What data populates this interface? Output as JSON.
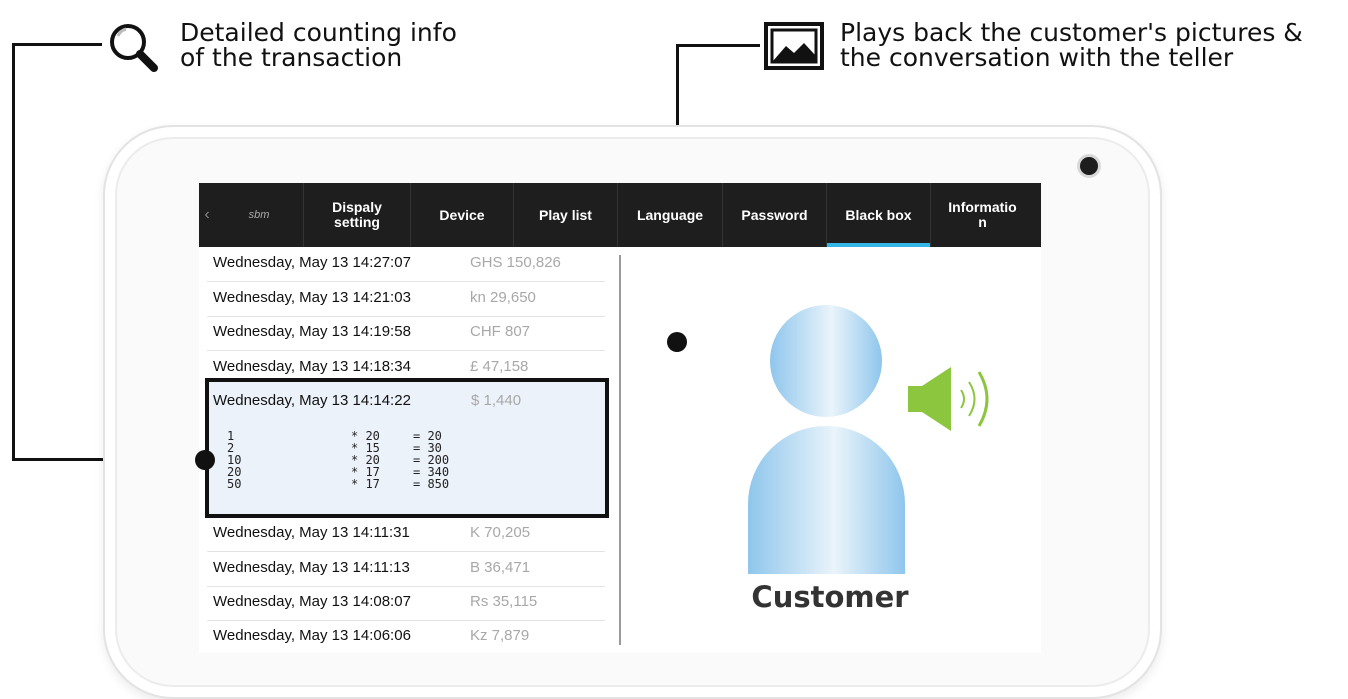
{
  "callouts": {
    "left": "Detailed counting info\nof the transaction",
    "right": "Plays back the customer's pictures &\nthe conversation with the teller"
  },
  "nav": {
    "back": "‹",
    "logo": "sbm",
    "tabs": [
      "Dispaly\nsetting",
      "Device",
      "Play list",
      "Language",
      "Password",
      "Black box",
      "Informatio\nn"
    ],
    "active_tab": "Black box",
    "accent_color": "#33b5e5"
  },
  "transactions": [
    {
      "datetime": "Wednesday, May 13  14:27:07",
      "amount": "GHS 150,826"
    },
    {
      "datetime": "Wednesday, May 13  14:21:03",
      "amount": "kn 29,650"
    },
    {
      "datetime": "Wednesday, May 13  14:19:58",
      "amount": "CHF 807"
    },
    {
      "datetime": "Wednesday, May 13  14:18:34",
      "amount": "£ 47,158"
    },
    {
      "datetime": "Wednesday, May 13  14:14:22",
      "amount": "$ 1,440"
    },
    {
      "datetime": "Wednesday, May 13  14:11:31",
      "amount": "K 70,205"
    },
    {
      "datetime": "Wednesday, May 13  14:11:13",
      "amount": "B 36,471"
    },
    {
      "datetime": "Wednesday, May 13  14:08:07",
      "amount": "Rs 35,115"
    },
    {
      "datetime": "Wednesday, May 13  14:06:06",
      "amount": "Kz 7,879"
    }
  ],
  "detail": {
    "datetime": "Wednesday, May 13  14:14:22",
    "amount": "$ 1,440",
    "breakdown": [
      {
        "denom": "1",
        "count": "* 20",
        "total": "= 20"
      },
      {
        "denom": "2",
        "count": "* 15",
        "total": "= 30"
      },
      {
        "denom": "10",
        "count": "* 20",
        "total": "= 200"
      },
      {
        "denom": "20",
        "count": "* 17",
        "total": "= 340"
      },
      {
        "denom": "50",
        "count": "* 17",
        "total": "= 850"
      }
    ]
  },
  "viewer": {
    "label": "Customer",
    "person_color": "#8fc6ec",
    "speaker_color": "#8cc63f",
    "icons": [
      "customer-avatar-icon",
      "speaker-icon"
    ]
  }
}
